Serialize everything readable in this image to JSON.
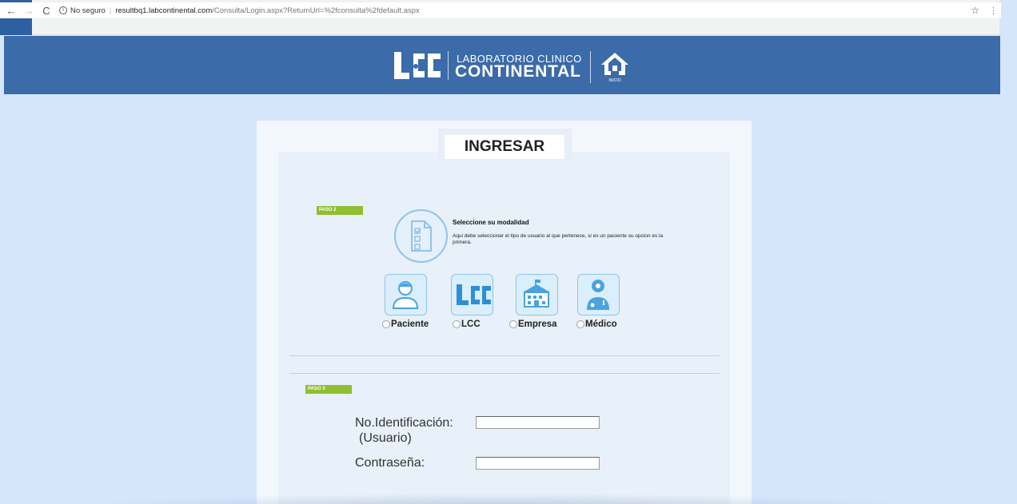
{
  "browser": {
    "back_icon": "←",
    "forward_icon": "→",
    "reload_icon": "C",
    "security_label": "No seguro",
    "url_host": "resultbq1.labcontinental.com",
    "url_path": "/Consulta/Login.aspx?ReturnUrl=%2fconsulta%2fdefault.aspx",
    "star_icon": "☆",
    "menu_icon": "⋮"
  },
  "header": {
    "brand_top": "LABORATORIO CLINICO",
    "brand_bottom": "CONTINENTAL",
    "home_label": "INICIO"
  },
  "login": {
    "title": "INGRESAR",
    "step2": {
      "tag": "PASO 2",
      "heading": "Seleccione su modalidad",
      "description": "Aqui debe seleccionar el tipo de usuario al que pertenece, si es un paciente su opcion es la primera."
    },
    "options": [
      {
        "label": "Paciente",
        "icon": "patient-icon"
      },
      {
        "label": "LCC",
        "icon": "lcc-logo-icon"
      },
      {
        "label": "Empresa",
        "icon": "building-icon"
      },
      {
        "label": "Médico",
        "icon": "doctor-icon"
      }
    ],
    "step3": {
      "tag": "PASO 3",
      "id_label": "No.Identificación:",
      "id_sublabel": "(Usuario)",
      "id_value": "",
      "password_label": "Contraseña:",
      "password_value": ""
    }
  },
  "colors": {
    "header_bg": "#3b6ba9",
    "page_bg": "#d6e6fa",
    "step_tag": "#8fbf2e",
    "icon_stroke": "#8ec4ea"
  }
}
